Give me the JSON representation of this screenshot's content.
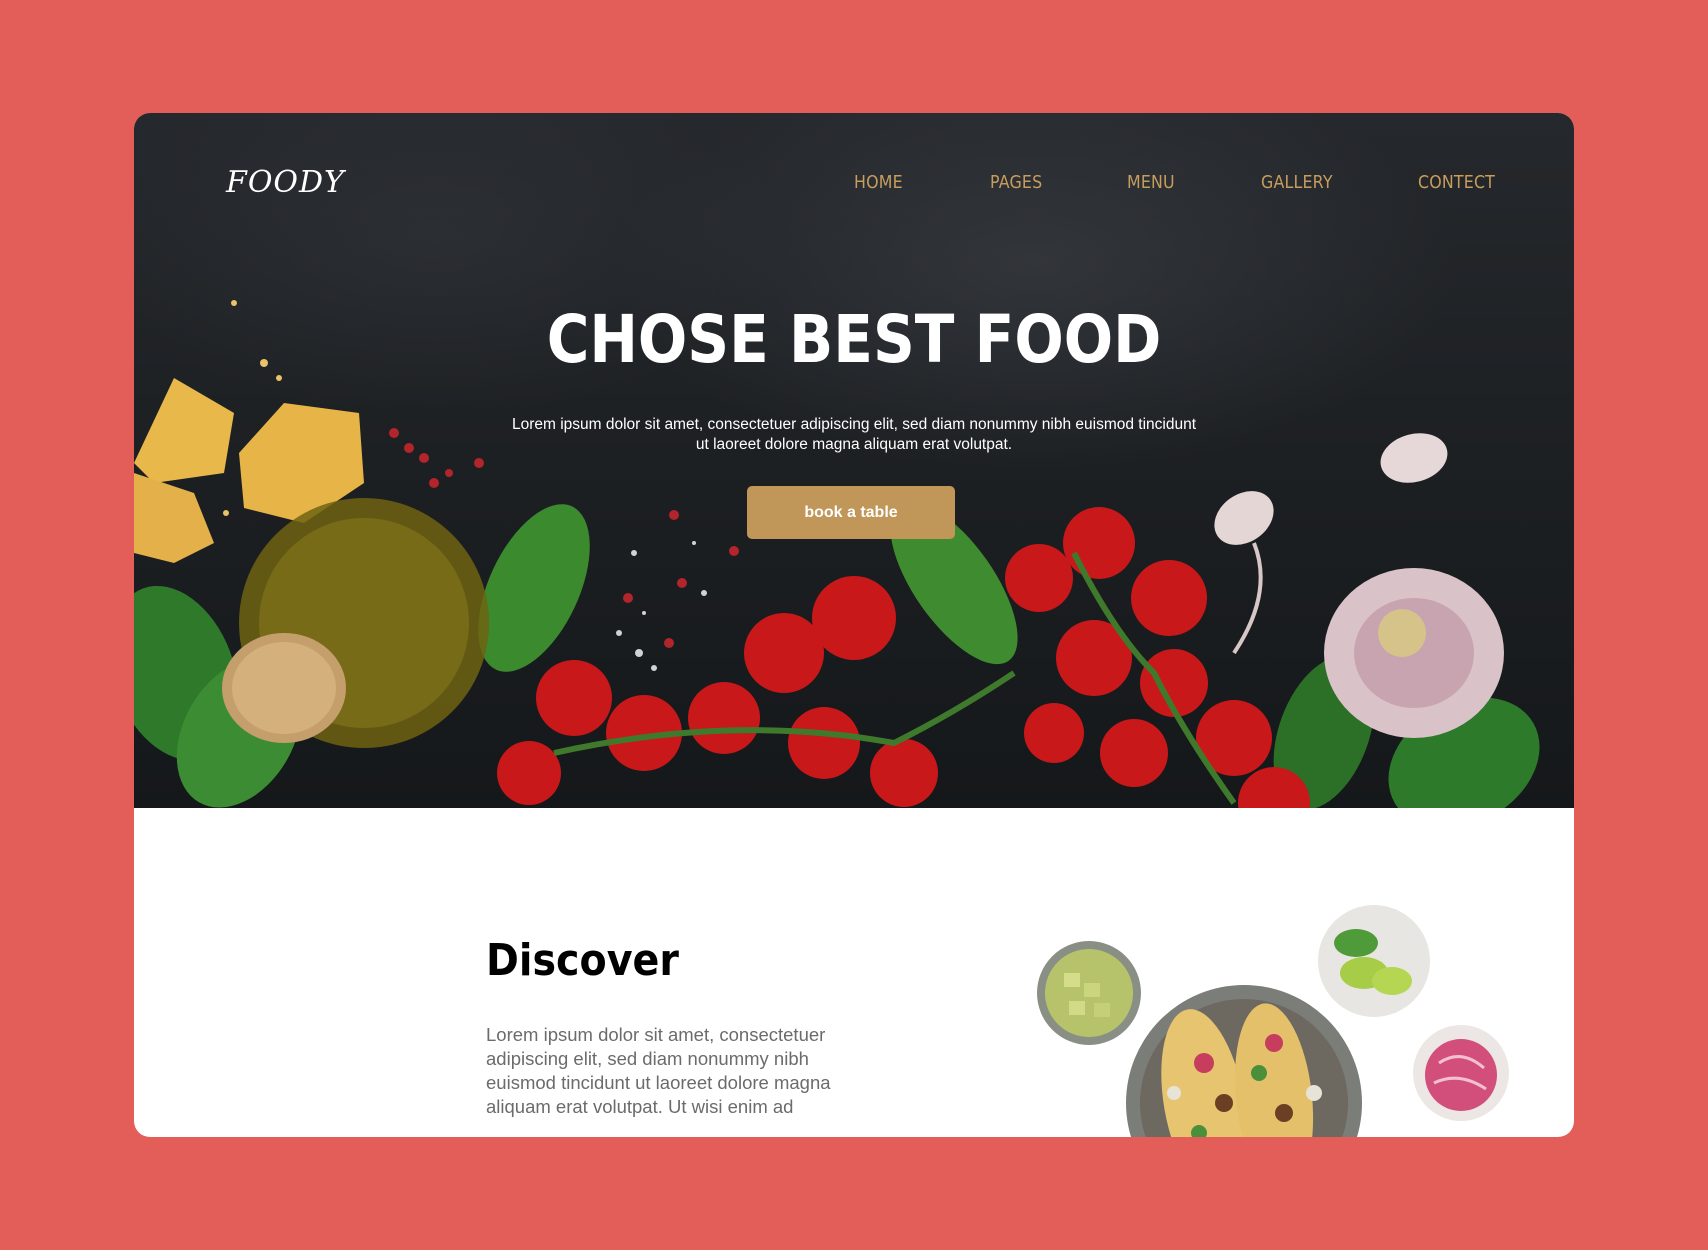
{
  "brand": {
    "logo": "FOODY"
  },
  "nav": {
    "items": [
      {
        "label": "HOME"
      },
      {
        "label": "PAGES"
      },
      {
        "label": "MENU"
      },
      {
        "label": "GALLERY"
      },
      {
        "label": "CONTECT"
      }
    ]
  },
  "hero": {
    "title": "CHOSE BEST FOOD",
    "text": "Lorem ipsum dolor sit amet, consectetuer adipiscing elit, sed diam nonummy nibh euismod tincidunt ut laoreet dolore magna aliquam erat volutpat.",
    "cta_label": "book a table"
  },
  "discover": {
    "title": "Discover",
    "text": "Lorem ipsum dolor sit amet, consectetuer adipiscing elit, sed diam nonummy nibh euismod tincidunt ut laoreet dolore magna aliquam erat volutpat. Ut wisi enim ad"
  },
  "colors": {
    "page_background": "#e45e59",
    "accent_gold": "#c09659",
    "nav_text": "#c79d5e",
    "hero_dark": "#1c1f22"
  }
}
